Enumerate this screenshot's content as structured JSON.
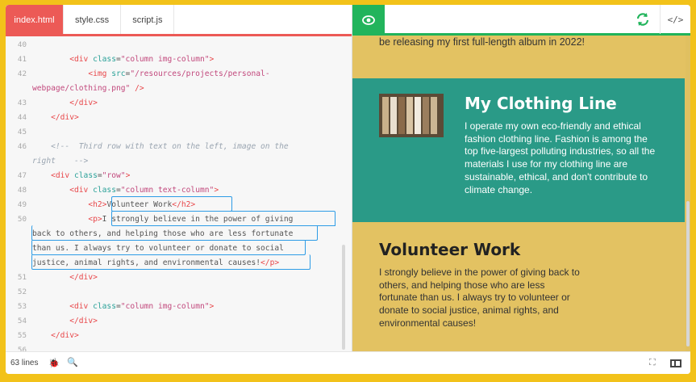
{
  "tabs": [
    {
      "label": "index.html",
      "active": true
    },
    {
      "label": "style.css",
      "active": false
    },
    {
      "label": "script.js",
      "active": false
    }
  ],
  "code_lines": [
    {
      "n": "40",
      "html": ""
    },
    {
      "n": "41",
      "html": "        <span class=\"tg\">&lt;div</span> <span class=\"at\">class</span>=<span class=\"sv\">\"column img-column\"</span><span class=\"tg\">&gt;</span>"
    },
    {
      "n": "42",
      "html": "            <span class=\"tg\">&lt;img</span> <span class=\"at\">src</span>=<span class=\"sv\">\"/resources/projects/personal-</span>"
    },
    {
      "n": "",
      "html": "<span class=\"sv\">webpage/clothing.png\"</span> <span class=\"tg\">/&gt;</span>"
    },
    {
      "n": "43",
      "html": "        <span class=\"tg\">&lt;/div&gt;</span>"
    },
    {
      "n": "44",
      "html": "    <span class=\"tg\">&lt;/div&gt;</span>"
    },
    {
      "n": "45",
      "html": ""
    },
    {
      "n": "46",
      "html": "    <span class=\"cm\">&lt;!--  Third row with text on the left, image on the</span>"
    },
    {
      "n": "",
      "html": "<span class=\"cm\">right    --&gt;</span>"
    },
    {
      "n": "47",
      "html": "    <span class=\"tg\">&lt;div</span> <span class=\"at\">class</span>=<span class=\"sv\">\"row\"</span><span class=\"tg\">&gt;</span>"
    },
    {
      "n": "48",
      "html": "        <span class=\"tg\">&lt;div</span> <span class=\"at\">class</span>=<span class=\"sv\">\"column text-column\"</span><span class=\"tg\">&gt;</span>"
    },
    {
      "n": "49",
      "html": "            <span class=\"tg\">&lt;h2&gt;</span>Volunteer Work<span class=\"tg\">&lt;/h2&gt;</span>"
    },
    {
      "n": "50",
      "html": "            <span class=\"tg\">&lt;p&gt;</span>I strongly believe in the power of giving"
    },
    {
      "n": "",
      "html": "back to others, and helping those who are less fortunate"
    },
    {
      "n": "",
      "html": "than us. I always try to volunteer or donate to social"
    },
    {
      "n": "",
      "html": "justice, animal rights, and environmental causes!<span class=\"tg\">&lt;/p&gt;</span>"
    },
    {
      "n": "51",
      "html": "        <span class=\"tg\">&lt;/div&gt;</span>"
    },
    {
      "n": "52",
      "html": ""
    },
    {
      "n": "53",
      "html": "        <span class=\"tg\">&lt;div</span> <span class=\"at\">class</span>=<span class=\"sv\">\"column img-column\"</span><span class=\"tg\">&gt;</span>"
    },
    {
      "n": "54",
      "html": "        <span class=\"tg\">&lt;/div&gt;</span>"
    },
    {
      "n": "55",
      "html": "    <span class=\"tg\">&lt;/div&gt;</span>"
    },
    {
      "n": "56",
      "html": ""
    }
  ],
  "preview": {
    "intro": "be releasing my first full-length album in 2022!",
    "clothing_title": "My Clothing Line",
    "clothing_text": "I operate my own eco-friendly and ethical fashion clothing line. Fashion is among the top five-largest polluting industries, so all the materials I use for my clothing line are sustainable, ethical, and don't contribute to climate change.",
    "volunteer_title": "Volunteer Work",
    "volunteer_text": "I strongly believe in the power of giving back to others, and helping those who are less fortunate than us. I always try to volunteer or donate to social justice, animal rights, and environmental causes!"
  },
  "toolbar": {
    "code_toggle": "</>"
  },
  "status": {
    "lines": "63 lines"
  },
  "colors": {
    "accent_red": "#ec5a56",
    "accent_green": "#22b45c",
    "teal": "#2a9a87",
    "mustard": "#e3c262",
    "frame": "#f2c21a"
  }
}
